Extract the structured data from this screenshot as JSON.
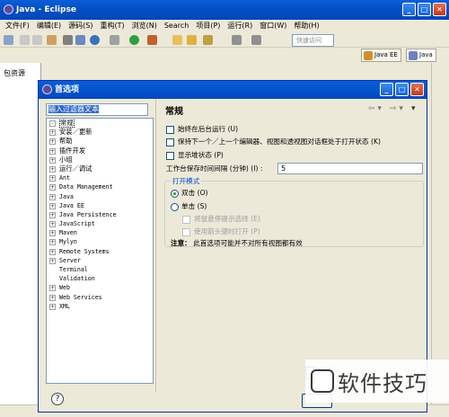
{
  "window": {
    "title": "Java - Eclipse"
  },
  "menubar": [
    "文件(F)",
    "编辑(E)",
    "源码(S)",
    "重构(T)",
    "浏览(N)",
    "Search",
    "项目(P)",
    "运行(R)",
    "窗口(W)",
    "帮助(H)"
  ],
  "quick_access": "快速访问",
  "perspectives": [
    "Java EE",
    "Java"
  ],
  "left_view": {
    "tab": "包资源"
  },
  "dialog": {
    "title": "首选项",
    "filter_text": "输入过滤器文本",
    "tree": [
      {
        "label": "常规",
        "exp": "-",
        "selected": true,
        "mono": false
      },
      {
        "label": "安装／更新",
        "exp": "+",
        "mono": false
      },
      {
        "label": "帮助",
        "exp": "+",
        "mono": false
      },
      {
        "label": "插件开发",
        "exp": "+",
        "mono": false
      },
      {
        "label": "小组",
        "exp": "+",
        "mono": false
      },
      {
        "label": "运行／调试",
        "exp": "+",
        "mono": false
      },
      {
        "label": "Ant",
        "exp": "+",
        "mono": true
      },
      {
        "label": "Data Management",
        "exp": "+",
        "mono": true
      },
      {
        "label": "Java",
        "exp": "+",
        "mono": true
      },
      {
        "label": "Java EE",
        "exp": "+",
        "mono": true
      },
      {
        "label": "Java Persistence",
        "exp": "+",
        "mono": true
      },
      {
        "label": "JavaScript",
        "exp": "+",
        "mono": true
      },
      {
        "label": "Maven",
        "exp": "+",
        "mono": true
      },
      {
        "label": "Mylyn",
        "exp": "+",
        "mono": true
      },
      {
        "label": "Remote Systems",
        "exp": "+",
        "mono": true
      },
      {
        "label": "Server",
        "exp": "+",
        "mono": true
      },
      {
        "label": "Terminal",
        "exp": "",
        "mono": true
      },
      {
        "label": "Validation",
        "exp": "",
        "mono": true
      },
      {
        "label": "Web",
        "exp": "+",
        "mono": true
      },
      {
        "label": "Web Services",
        "exp": "+",
        "mono": true
      },
      {
        "label": "XML",
        "exp": "+",
        "mono": true
      }
    ],
    "page": {
      "title": "常规",
      "checkboxes": [
        {
          "label": "始终在后台运行 (U)",
          "checked": false
        },
        {
          "label": "保持下一个／上一个编辑器、视图和透视图对话框处于打开状态 (K)",
          "checked": false
        },
        {
          "label": "显示堆状态 (P)",
          "checked": false
        }
      ],
      "autosave_label": "工作台保存时间间隔 (分钟) (I) :",
      "autosave_value": "5",
      "open_mode": {
        "label": "打开模式",
        "double_click": "双击 (O)",
        "single_click": "单击 (S)",
        "select_on_hover": "将鼠悬停提示选择 (E)",
        "open_with_arrows": "使用箭头键时打开 (P)",
        "selected": "double_click"
      },
      "note_label": "注意：",
      "note_text": "此首选项可能并不对所有视图都有效"
    },
    "help_symbol": "?"
  },
  "watermark": {
    "text": "软件技巧"
  }
}
